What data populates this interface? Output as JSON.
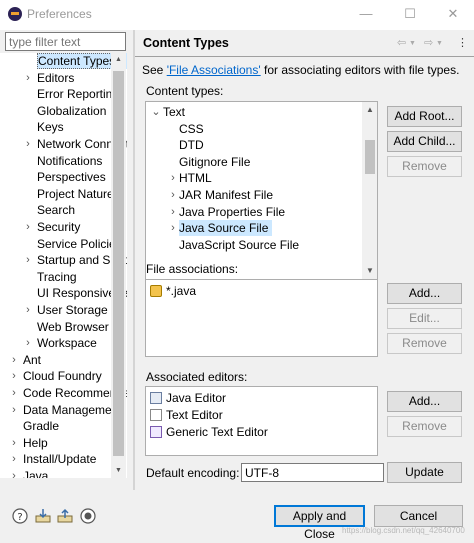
{
  "window": {
    "title": "Preferences",
    "controls": {
      "minimize": "—",
      "maximize": "☐",
      "close": "✕"
    }
  },
  "sidebar": {
    "filter_placeholder": "type filter text",
    "items": [
      {
        "label": "Content Types",
        "expander": "",
        "selected": true
      },
      {
        "label": "Editors",
        "expander": "›"
      },
      {
        "label": "Error Reporting",
        "expander": ""
      },
      {
        "label": "Globalization",
        "expander": ""
      },
      {
        "label": "Keys",
        "expander": ""
      },
      {
        "label": "Network Connections",
        "expander": "›"
      },
      {
        "label": "Notifications",
        "expander": ""
      },
      {
        "label": "Perspectives",
        "expander": ""
      },
      {
        "label": "Project Natures",
        "expander": ""
      },
      {
        "label": "Search",
        "expander": ""
      },
      {
        "label": "Security",
        "expander": "›"
      },
      {
        "label": "Service Policies",
        "expander": ""
      },
      {
        "label": "Startup and Shutdown",
        "expander": "›"
      },
      {
        "label": "Tracing",
        "expander": ""
      },
      {
        "label": "UI Responsiveness",
        "expander": ""
      },
      {
        "label": "User Storage",
        "expander": "›"
      },
      {
        "label": "Web Browser",
        "expander": ""
      },
      {
        "label": "Workspace",
        "expander": "›"
      },
      {
        "label": "Ant",
        "expander": "›"
      },
      {
        "label": "Cloud Foundry",
        "expander": "›"
      },
      {
        "label": "Code Recommenders",
        "expander": "›"
      },
      {
        "label": "Data Management",
        "expander": "›"
      },
      {
        "label": "Gradle",
        "expander": ""
      },
      {
        "label": "Help",
        "expander": "›"
      },
      {
        "label": "Install/Update",
        "expander": "›"
      },
      {
        "label": "Java",
        "expander": "›"
      }
    ]
  },
  "page": {
    "title": "Content Types",
    "nav": {
      "back": "⇦",
      "forward": "⇨",
      "menu": "⋮"
    },
    "see_before": "See ",
    "see_link": "'File Associations'",
    "see_after": " for associating editors with file types.",
    "content_types_label": "Content types:",
    "content_types": [
      {
        "label": "Text",
        "expander": "⌄"
      },
      {
        "label": "CSS",
        "expander": ""
      },
      {
        "label": "DTD",
        "expander": ""
      },
      {
        "label": "Gitignore File",
        "expander": ""
      },
      {
        "label": "HTML",
        "expander": "›"
      },
      {
        "label": "JAR Manifest File",
        "expander": "›"
      },
      {
        "label": "Java Properties File",
        "expander": "›"
      },
      {
        "label": "Java Source File",
        "expander": "›",
        "selected": true
      },
      {
        "label": "JavaScript Source File",
        "expander": ""
      }
    ],
    "ct_buttons": {
      "add_root": "Add Root...",
      "add_child": "Add Child...",
      "remove": "Remove"
    },
    "file_assoc_label": "File associations:",
    "file_associations": [
      {
        "label": "*.java",
        "icon": "lock-icon"
      }
    ],
    "fa_buttons": {
      "add": "Add...",
      "edit": "Edit...",
      "remove": "Remove"
    },
    "assoc_editors_label": "Associated editors:",
    "associated_editors": [
      {
        "label": "Java Editor",
        "icon": "java-editor-icon"
      },
      {
        "label": "Text Editor",
        "icon": "text-editor-icon"
      },
      {
        "label": "Generic Text Editor",
        "icon": "generic-editor-icon"
      }
    ],
    "ae_buttons": {
      "add": "Add...",
      "remove": "Remove"
    },
    "encoding_label": "Default encoding:",
    "encoding_value": "UTF-8",
    "update_label": "Update"
  },
  "footer": {
    "icons": [
      "help-icon",
      "import-icon",
      "export-icon",
      "record-icon"
    ],
    "apply_close": "Apply and Close",
    "cancel": "Cancel",
    "watermark": "https://blog.csdn.net/qq_42640700"
  }
}
